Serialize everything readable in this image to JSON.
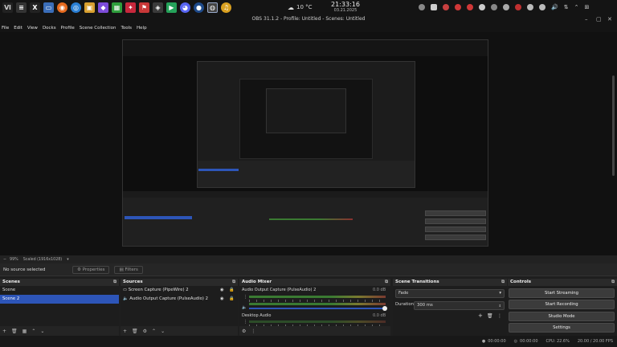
{
  "taskbar": {
    "clock_time": "21:33:16",
    "clock_date": "03.21.2025",
    "weather": "10 °C"
  },
  "window": {
    "title": "OBS 31.1.2 - Profile: Untitled - Scenes: Untitled",
    "btn_min": "–",
    "btn_max": "▢",
    "btn_close": "✕"
  },
  "menu": [
    "File",
    "Edit",
    "View",
    "Docks",
    "Profile",
    "Scene Collection",
    "Tools",
    "Help"
  ],
  "toolbar": {
    "zoom": "99%",
    "mode": "Scaled (1916x1028)"
  },
  "source_bar": {
    "no_source": "No source selected",
    "properties": "Properties",
    "filters": "Filters"
  },
  "scenes": {
    "header": "Scenes",
    "items": [
      "Scene",
      "Scene 2"
    ],
    "selected": 1
  },
  "sources": {
    "header": "Sources",
    "items": [
      "Screen Capture (PipeWire) 2",
      "Audio Output Capture (PulseAudio) 2"
    ]
  },
  "audio": {
    "header": "Audio Mixer",
    "channels": [
      {
        "name": "Audio Output Capture (PulseAudio) 2",
        "db": "0.0 dB"
      },
      {
        "name": "Desktop Audio",
        "db": "0.0 dB"
      }
    ]
  },
  "transitions": {
    "header": "Scene Transitions",
    "type": "Fade",
    "duration_label": "Duration",
    "duration_value": "300 ms"
  },
  "controls": {
    "header": "Controls",
    "buttons": [
      "Start Streaming",
      "Start Recording",
      "Studio Mode",
      "Settings"
    ]
  },
  "status": {
    "rec_time": "00:00:00",
    "stream_time": "00:00:00",
    "cpu": "CPU: 22.6%",
    "fps": "20.00 / 20.00 FPS"
  },
  "colors": {
    "accent": "#2d55b8",
    "bg": "#1e1e1e",
    "panel": "#262626"
  }
}
